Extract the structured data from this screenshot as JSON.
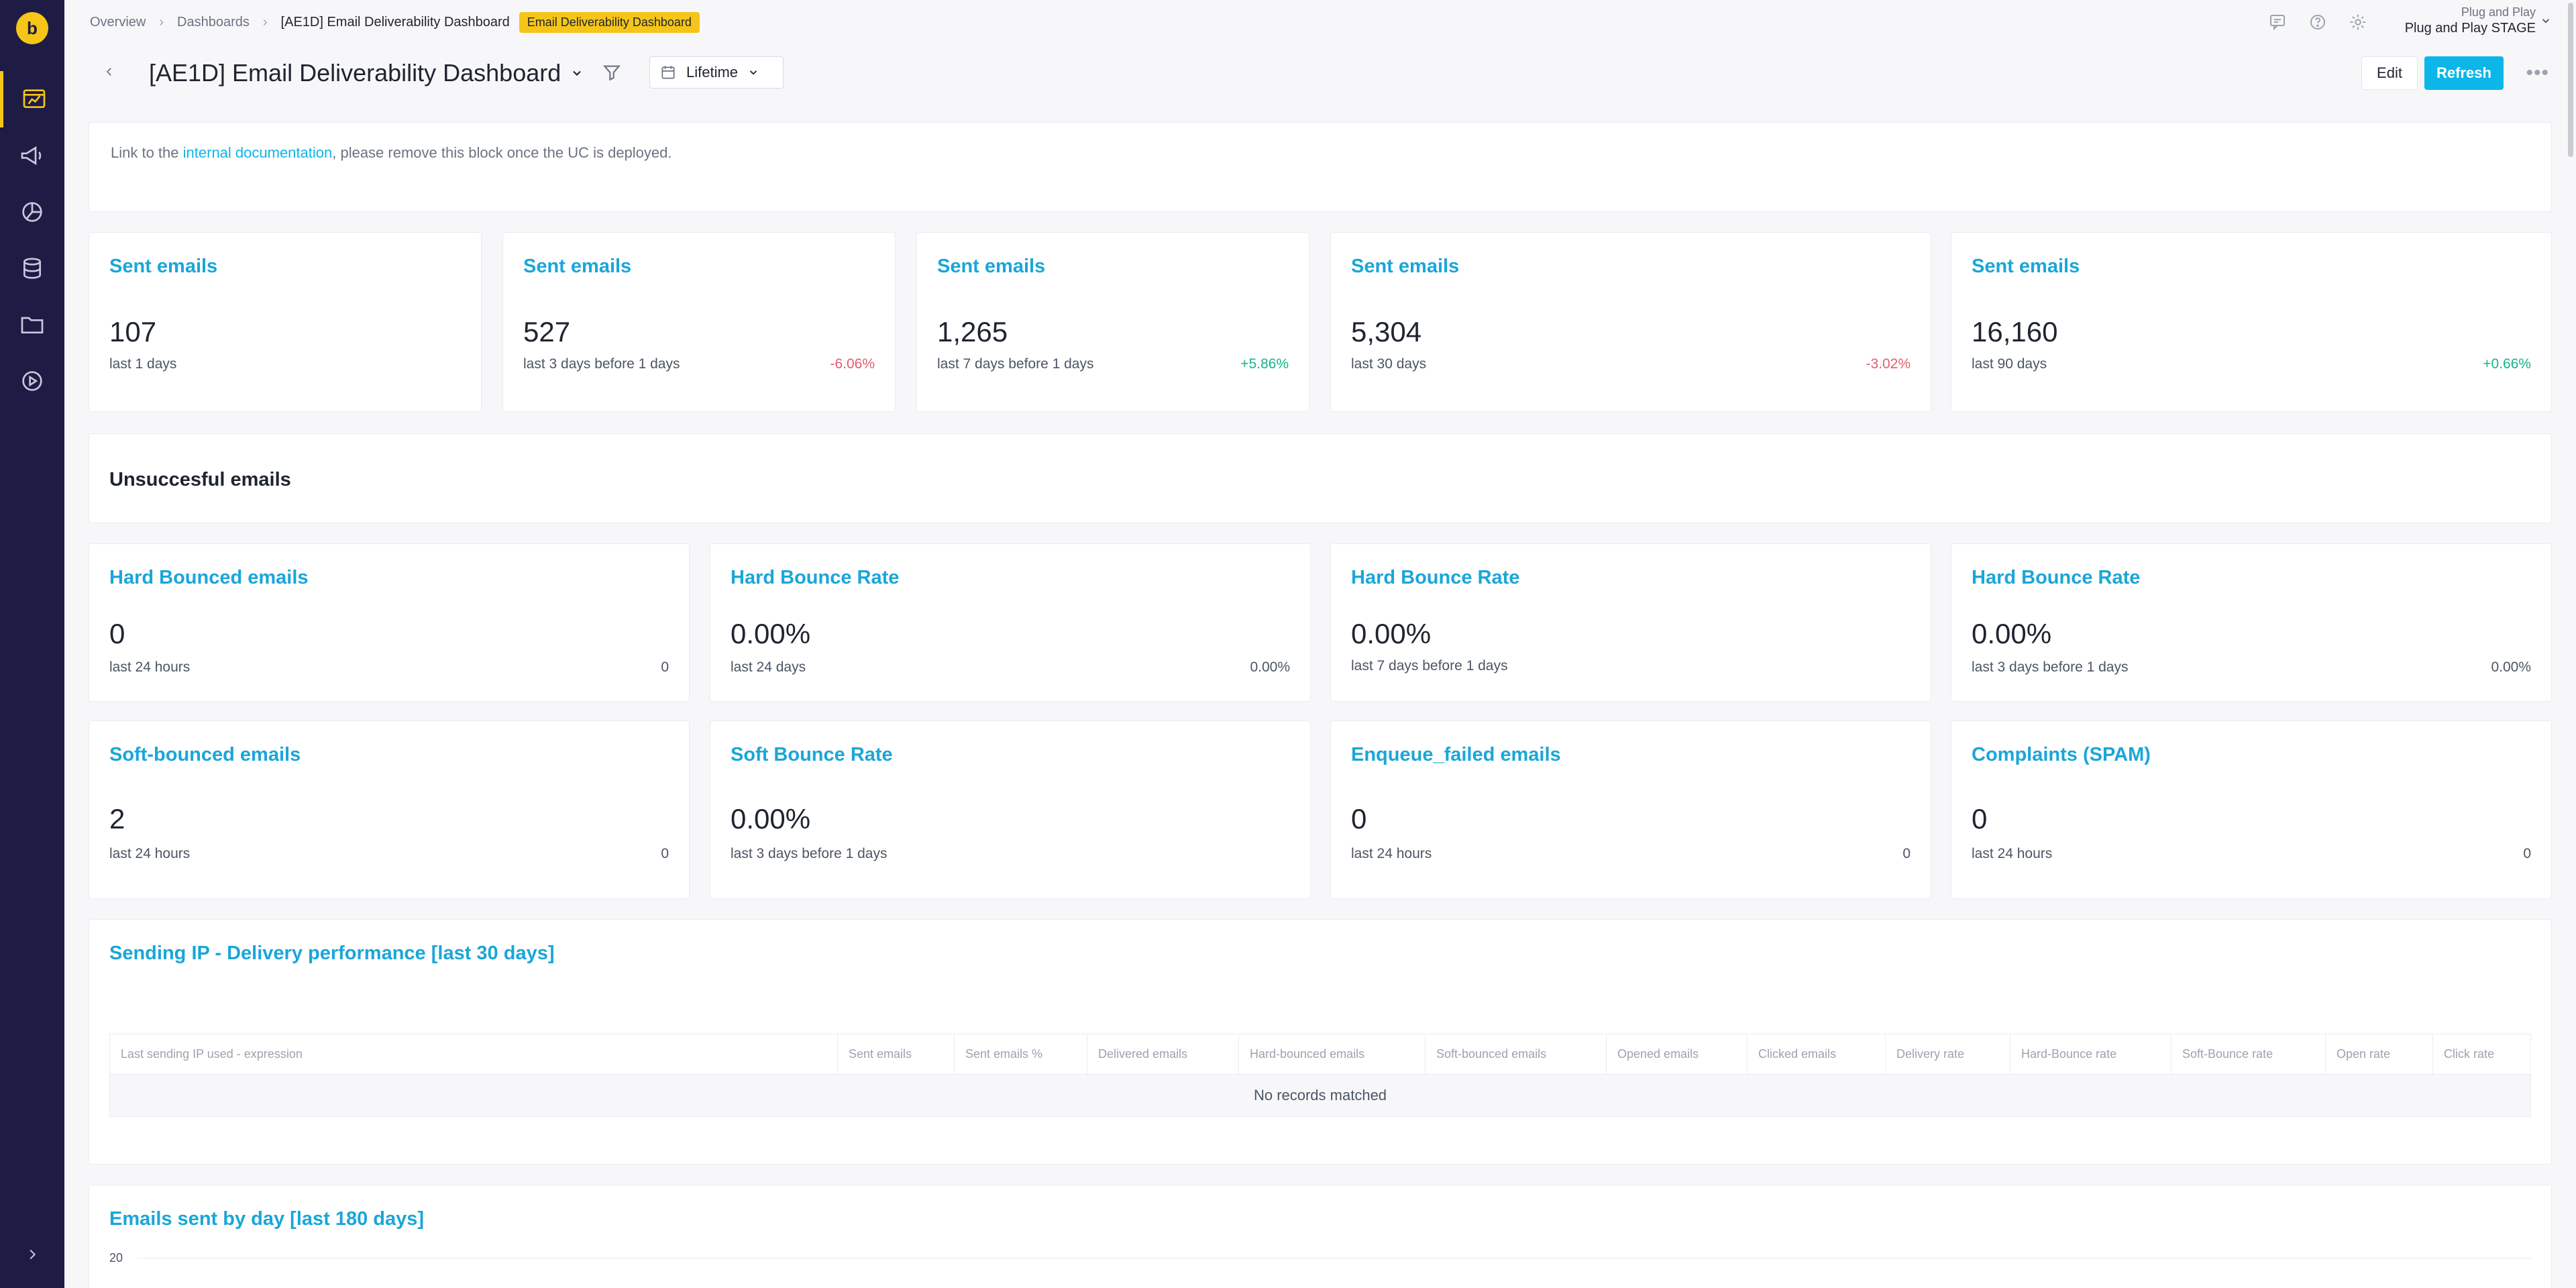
{
  "breadcrumb": {
    "items": [
      "Overview",
      "Dashboards",
      "[AE1D] Email Deliverability Dashboard"
    ],
    "badge": "Email Deliverability Dashboard"
  },
  "org": {
    "label": "Plug and Play",
    "name": "Plug and Play STAGE"
  },
  "title": "[AE1D] Email Deliverability Dashboard",
  "date_range": "Lifetime",
  "actions": {
    "edit": "Edit",
    "refresh": "Refresh"
  },
  "info": {
    "prefix": "Link to the ",
    "link": "internal documentation",
    "suffix": ", please remove this block once the UC is deployed."
  },
  "sent_cards": [
    {
      "title": "Sent emails",
      "value": "107",
      "sub": "last 1 days",
      "change": ""
    },
    {
      "title": "Sent emails",
      "value": "527",
      "sub": "last 3 days before 1 days",
      "change": "-6.06%"
    },
    {
      "title": "Sent emails",
      "value": "1,265",
      "sub": "last 7 days before 1 days",
      "change": "+5.86%"
    },
    {
      "title": "Sent emails",
      "value": "5,304",
      "sub": "last 30 days",
      "change": "-3.02%"
    },
    {
      "title": "Sent emails",
      "value": "16,160",
      "sub": "last 90 days",
      "change": "+0.66%"
    }
  ],
  "unsuccessful_title": "Unsuccesful emails",
  "bounce_cards": [
    {
      "title": "Hard Bounced emails",
      "value": "0",
      "sub": "last 24 hours",
      "change": "0"
    },
    {
      "title": "Hard Bounce Rate",
      "value": "0.00%",
      "sub": "last 24 days",
      "change": "0.00%"
    },
    {
      "title": "Hard Bounce Rate",
      "value": "0.00%",
      "sub": "last 7 days before 1 days",
      "change": ""
    },
    {
      "title": "Hard Bounce Rate",
      "value": "0.00%",
      "sub": "last 3 days before 1 days",
      "change": "0.00%"
    }
  ],
  "soft_cards": [
    {
      "title": "Soft-bounced emails",
      "value": "2",
      "sub": "last 24 hours",
      "change": "0"
    },
    {
      "title": "Soft Bounce Rate",
      "value": "0.00%",
      "sub": "last 3 days before 1 days",
      "change": ""
    },
    {
      "title": "Enqueue_failed emails",
      "value": "0",
      "sub": "last 24 hours",
      "change": "0"
    },
    {
      "title": "Complaints (SPAM)",
      "value": "0",
      "sub": "last 24 hours",
      "change": "0"
    }
  ],
  "ip_table": {
    "title": "Sending IP - Delivery performance [last 30 days]",
    "columns": [
      "Last sending IP used - expression",
      "Sent emails",
      "Sent emails %",
      "Delivered emails",
      "Hard-bounced emails",
      "Soft-bounced emails",
      "Opened emails",
      "Clicked emails",
      "Delivery rate",
      "Hard-Bounce rate",
      "Soft-Bounce rate",
      "Open rate",
      "Click rate"
    ],
    "empty": "No records matched"
  },
  "by_day": {
    "title": "Emails sent by day [last 180 days]",
    "y_tick": "20"
  },
  "colors": {
    "accent": "#0cb6e8",
    "brand": "#f5c518",
    "sidebar": "#1e1b45",
    "negative": "#e05d6f",
    "positive": "#18b38a"
  },
  "icons": {
    "sidebar": [
      "dashboard-icon",
      "megaphone-icon",
      "pie-chart-icon",
      "database-icon",
      "folder-icon",
      "play-icon"
    ],
    "top": [
      "comment-icon",
      "help-icon",
      "settings-icon"
    ]
  }
}
